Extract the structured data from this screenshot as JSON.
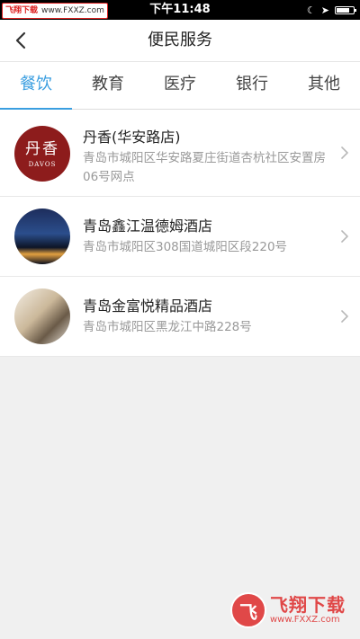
{
  "status_bar": {
    "watermark_name": "飞翔下载",
    "watermark_url": "www.FXXZ.com",
    "time": "下午11:48"
  },
  "nav": {
    "title": "便民服务"
  },
  "tabs": [
    {
      "label": "餐饮",
      "active": true
    },
    {
      "label": "教育",
      "active": false
    },
    {
      "label": "医疗",
      "active": false
    },
    {
      "label": "银行",
      "active": false
    },
    {
      "label": "其他",
      "active": false
    }
  ],
  "list": [
    {
      "title": "丹香(华安路店)",
      "address": "青岛市城阳区华安路夏庄街道杏杭社区安置房06号网点",
      "logo_cn": "丹香",
      "logo_en": "DAVOS"
    },
    {
      "title": "青岛鑫江温德姆酒店",
      "address": "青岛市城阳区308国道城阳区段220号"
    },
    {
      "title": "青岛金富悦精品酒店",
      "address": "青岛市城阳区黑龙江中路228号"
    }
  ],
  "watermark_bottom": {
    "cn": "飞翔下载",
    "en": "www.FXXZ.com"
  },
  "colors": {
    "accent": "#3a9ee0",
    "background": "#f0f0f0",
    "status_bar": "#000000"
  },
  "icons": [
    "back-arrow-icon",
    "chevron-right-icon",
    "moon-icon",
    "location-arrow-icon",
    "battery-icon"
  ]
}
